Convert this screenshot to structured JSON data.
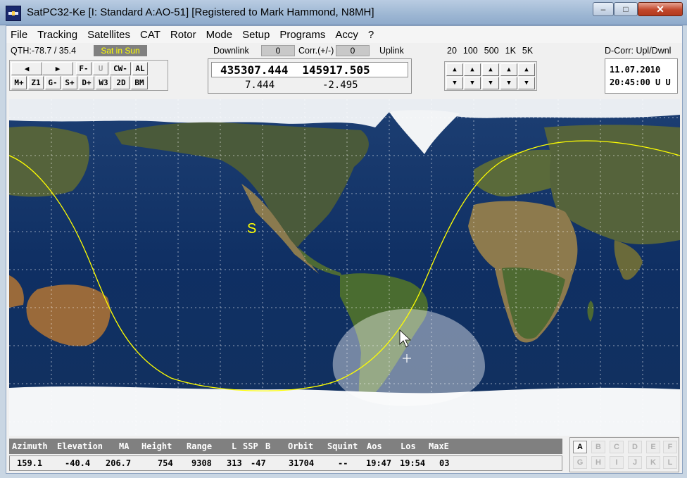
{
  "window": {
    "title": "SatPC32-Ke [I: Standard  A:AO-51]  [Registered to Mark Hammond, N8MH]",
    "min_glyph": "–",
    "max_glyph": "□",
    "close_glyph": "✕"
  },
  "menu": [
    "File",
    "Tracking",
    "Satellites",
    "CAT",
    "Rotor",
    "Mode",
    "Setup",
    "Programs",
    "Accy",
    "?"
  ],
  "status": {
    "qth": "QTH:-78.7 / 35.4",
    "sat_in_sun": "Sat in Sun",
    "downlink_label": "Downlink",
    "downlink_corr": "0",
    "corr_label": "Corr.(+/-)",
    "uplink_corr": "0",
    "uplink_label": "Uplink",
    "steps": [
      "20",
      "100",
      "500",
      "1K",
      "5K"
    ],
    "dcorr_label": "D-Corr: Upl/Dwnl"
  },
  "buttons_row1": [
    "◀",
    "▶",
    "F-",
    "U",
    "CW-",
    "AL"
  ],
  "buttons_row2": [
    "M+",
    "Z1",
    "G-",
    "S+",
    "D+",
    "W3",
    "2D",
    "BM"
  ],
  "frequency": {
    "downlink": "435307.444",
    "uplink": "145917.505",
    "downlink_doppler": "7.444",
    "uplink_doppler": "-2.495"
  },
  "arrows": {
    "up": "▲",
    "down": "▼"
  },
  "datetime": {
    "date": "11.07.2010",
    "time": "20:45:00 U U"
  },
  "map": {
    "sun_marker": "S"
  },
  "table": {
    "headers": [
      "Azimuth",
      "Elevation",
      "MA",
      "Height",
      "Range",
      "L",
      "SSP",
      "B",
      "Orbit",
      "Squint",
      "Aos",
      "Los",
      "MaxE"
    ],
    "values": [
      "159.1",
      "-40.4",
      "206.7",
      "754",
      "9308",
      "313",
      "-47",
      "31704",
      "--",
      "19:47",
      "19:54",
      "03"
    ]
  },
  "slots": [
    "A",
    "B",
    "C",
    "D",
    "E",
    "F",
    "G",
    "H",
    "I",
    "J",
    "K",
    "L"
  ],
  "colors": {
    "sat_in_sun_text": "#ffff00",
    "track": "#ffff00",
    "footprint": "#ffffff",
    "header_bg": "#808080"
  }
}
